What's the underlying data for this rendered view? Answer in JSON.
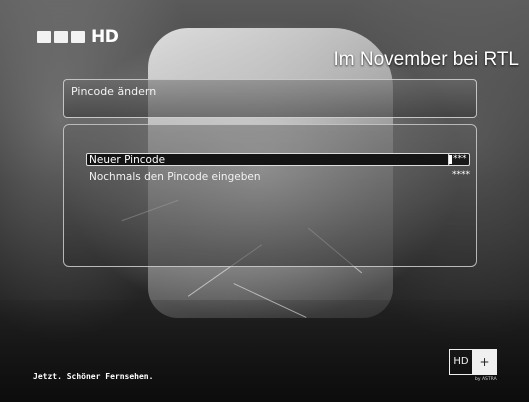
{
  "channel": {
    "logo_hd": "HD"
  },
  "promo": {
    "text": "Im November bei RTL"
  },
  "header": {
    "title": "Pincode ändern"
  },
  "pin_form": {
    "rows": [
      {
        "label": "Neuer Pincode",
        "value": "***",
        "selected": true
      },
      {
        "label": "Nochmals den Pincode eingeben",
        "value": "****",
        "selected": false
      }
    ]
  },
  "footer": {
    "tagline": "Jetzt. Schöner Fernsehen."
  },
  "hdplus": {
    "hd": "HD",
    "plus": "+",
    "sub": "by ASTRA"
  },
  "colors": {
    "text": "#f2f2f2",
    "panel_border": "#d7d7d7",
    "selection_bar": "#141414"
  }
}
